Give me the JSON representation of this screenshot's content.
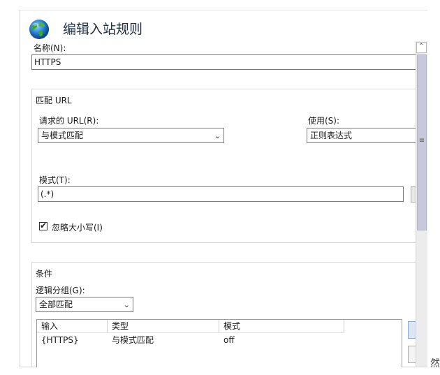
{
  "header": {
    "title": "编辑入站规则",
    "icon": "globe-icon"
  },
  "name_field": {
    "label": "名称(N):",
    "value": "HTTPS"
  },
  "match_url": {
    "legend": "匹配 URL",
    "requested_url": {
      "label": "请求的 URL(R):",
      "value": "与模式匹配"
    },
    "using": {
      "label": "使用(S):",
      "value": "正则表达式"
    },
    "pattern": {
      "label": "模式(T):",
      "value": "(.*)"
    },
    "ignore_case": {
      "label": "忽略大小写(I)",
      "checked": true
    }
  },
  "conditions": {
    "legend": "条件",
    "logical_grouping": {
      "label": "逻辑分组(G):",
      "value": "全部匹配"
    },
    "table": {
      "columns": [
        "输入",
        "类型",
        "模式"
      ],
      "rows": [
        {
          "input": "{HTTPS}",
          "type": "与模式匹配",
          "pattern": "off"
        }
      ]
    }
  },
  "stray_glyph": "然",
  "colors": {
    "title": "#1e2f45",
    "scroll_thumb": "#c8c8dc",
    "border": "#7a7a7a"
  }
}
